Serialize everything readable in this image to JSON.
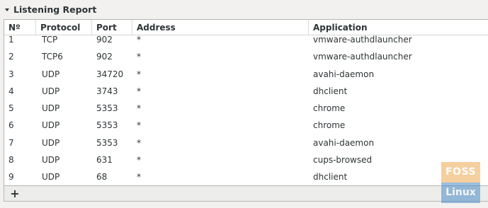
{
  "section": {
    "title": "Listening Report"
  },
  "table": {
    "columns": [
      "Nº",
      "Protocol",
      "Port",
      "Address",
      "Application"
    ],
    "rows": [
      {
        "n": "1",
        "protocol": "TCP",
        "port": "902",
        "address": "*",
        "application": "vmware-authdlauncher"
      },
      {
        "n": "2",
        "protocol": "TCP6",
        "port": "902",
        "address": "*",
        "application": "vmware-authdlauncher"
      },
      {
        "n": "3",
        "protocol": "UDP",
        "port": "34720",
        "address": "*",
        "application": "avahi-daemon"
      },
      {
        "n": "4",
        "protocol": "UDP",
        "port": "3743",
        "address": "*",
        "application": "dhclient"
      },
      {
        "n": "5",
        "protocol": "UDP",
        "port": "5353",
        "address": "*",
        "application": "chrome"
      },
      {
        "n": "6",
        "protocol": "UDP",
        "port": "5353",
        "address": "*",
        "application": "chrome"
      },
      {
        "n": "7",
        "protocol": "UDP",
        "port": "5353",
        "address": "*",
        "application": "avahi-daemon"
      },
      {
        "n": "8",
        "protocol": "UDP",
        "port": "631",
        "address": "*",
        "application": "cups-browsed"
      },
      {
        "n": "9",
        "protocol": "UDP",
        "port": "68",
        "address": "*",
        "application": "dhclient"
      }
    ]
  },
  "toolbar": {
    "add_label": "+"
  },
  "watermark": {
    "line1": "FOSS",
    "line2": "Linux",
    "color_top": "#f0a850",
    "color_bottom": "#4a8cc8"
  }
}
